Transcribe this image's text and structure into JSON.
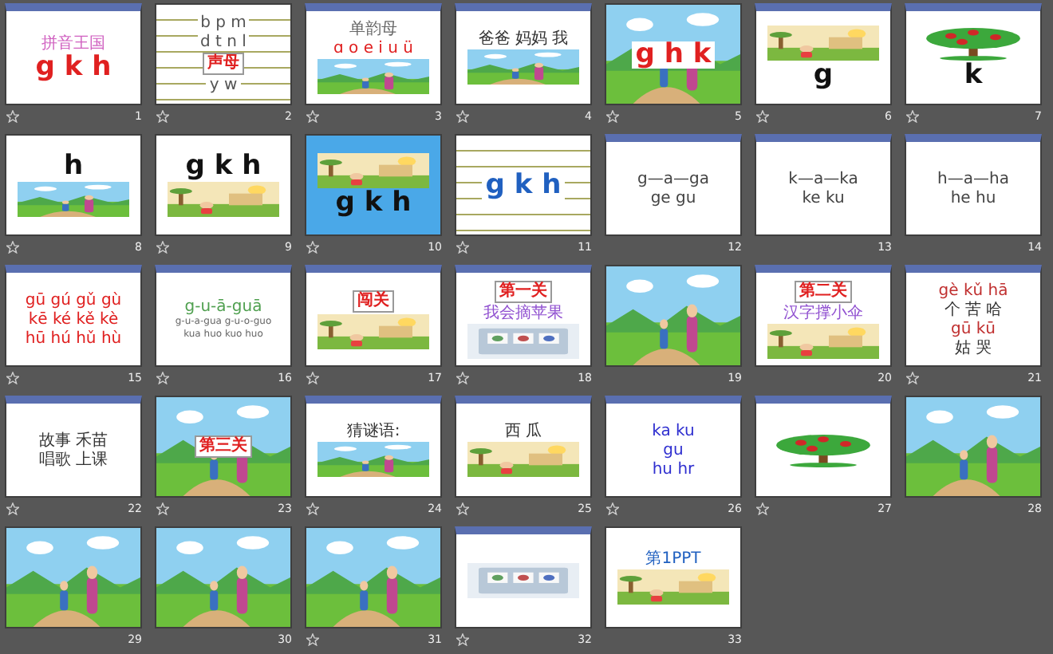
{
  "slides": [
    {
      "number": "1",
      "starred": true,
      "kind": "floral",
      "blocks": [
        {
          "kind": "heading",
          "text": "拼音王国",
          "color": "#d060c0"
        },
        {
          "kind": "letters",
          "text": "g k h",
          "color": "#e02020"
        }
      ]
    },
    {
      "number": "2",
      "starred": true,
      "kind": "lined",
      "blocks": [
        {
          "kind": "row",
          "text": "b p m",
          "color": "#555555"
        },
        {
          "kind": "row",
          "text": "d t n l",
          "color": "#555555"
        },
        {
          "kind": "badge",
          "text": "声母",
          "color": "#e02020"
        },
        {
          "kind": "row",
          "text": "y w",
          "color": "#555555"
        }
      ]
    },
    {
      "number": "3",
      "starred": true,
      "kind": "floral",
      "blocks": [
        {
          "kind": "heading",
          "text": "单韵母",
          "color": "#666666"
        },
        {
          "kind": "row",
          "text": "ɑ o e i u ü",
          "color": "#e02020"
        },
        {
          "kind": "picture"
        }
      ]
    },
    {
      "number": "4",
      "starred": true,
      "kind": "floral",
      "blocks": [
        {
          "kind": "row",
          "text": "爸爸 妈妈 我",
          "color": "#333333"
        },
        {
          "kind": "picture"
        }
      ]
    },
    {
      "number": "5",
      "starred": true,
      "kind": "scene",
      "blocks": [
        {
          "kind": "letters",
          "text": "g h k",
          "color": "#e02020"
        }
      ]
    },
    {
      "number": "6",
      "starred": true,
      "kind": "floral",
      "blocks": [
        {
          "kind": "picture"
        },
        {
          "kind": "letters",
          "text": "g",
          "color": "#111111"
        }
      ]
    },
    {
      "number": "7",
      "starred": true,
      "kind": "floral",
      "blocks": [
        {
          "kind": "picture"
        },
        {
          "kind": "letters",
          "text": "k",
          "color": "#111111"
        }
      ]
    },
    {
      "number": "8",
      "starred": true,
      "kind": "plain",
      "blocks": [
        {
          "kind": "letters",
          "text": "h",
          "color": "#111111"
        },
        {
          "kind": "picture"
        }
      ]
    },
    {
      "number": "9",
      "starred": true,
      "kind": "plain",
      "blocks": [
        {
          "kind": "letters",
          "text": "g k h",
          "color": "#111111"
        },
        {
          "kind": "picture"
        }
      ]
    },
    {
      "number": "10",
      "starred": true,
      "kind": "blue",
      "blocks": [
        {
          "kind": "picture"
        },
        {
          "kind": "letters",
          "text": "g k h",
          "color": "#111111"
        }
      ]
    },
    {
      "number": "11",
      "starred": true,
      "kind": "lined",
      "blocks": [
        {
          "kind": "letters",
          "text": "g k h",
          "color": "#2060c0"
        }
      ]
    },
    {
      "number": "12",
      "starred": false,
      "kind": "floral",
      "blocks": [
        {
          "kind": "row",
          "text": "g—a—ga",
          "color": "#444444"
        },
        {
          "kind": "row",
          "text": "ge gu",
          "color": "#444444"
        }
      ]
    },
    {
      "number": "13",
      "starred": false,
      "kind": "floral",
      "blocks": [
        {
          "kind": "row",
          "text": "k—a—ka",
          "color": "#444444"
        },
        {
          "kind": "row",
          "text": "ke ku",
          "color": "#444444"
        }
      ]
    },
    {
      "number": "14",
      "starred": false,
      "kind": "floral",
      "blocks": [
        {
          "kind": "row",
          "text": "h—a—ha",
          "color": "#444444"
        },
        {
          "kind": "row",
          "text": "he hu",
          "color": "#444444"
        }
      ]
    },
    {
      "number": "15",
      "starred": true,
      "kind": "floral",
      "blocks": [
        {
          "kind": "row",
          "text": "gū gú gǔ gù",
          "color": "#e02020"
        },
        {
          "kind": "row",
          "text": "kē ké kě kè",
          "color": "#e02020"
        },
        {
          "kind": "row",
          "text": "hū hú hǔ hù",
          "color": "#e02020"
        }
      ]
    },
    {
      "number": "16",
      "starred": true,
      "kind": "floral",
      "blocks": [
        {
          "kind": "row",
          "text": "g-u-ā-guā",
          "color": "#50a050"
        },
        {
          "kind": "caption",
          "text": "g-u-a-gua g-u-o-guo",
          "color": "#666666"
        },
        {
          "kind": "caption",
          "text": "kua huo kuo huo",
          "color": "#666666"
        }
      ]
    },
    {
      "number": "17",
      "starred": true,
      "kind": "floral",
      "blocks": [
        {
          "kind": "badge",
          "text": "闯关",
          "color": "#e02020"
        },
        {
          "kind": "picture"
        }
      ]
    },
    {
      "number": "18",
      "starred": true,
      "kind": "floral",
      "blocks": [
        {
          "kind": "badge",
          "text": "第一关",
          "color": "#e02020"
        },
        {
          "kind": "heading",
          "text": "我会摘苹果",
          "color": "#9050d0"
        },
        {
          "kind": "picture"
        }
      ]
    },
    {
      "number": "19",
      "starred": false,
      "kind": "scene"
    },
    {
      "number": "20",
      "starred": false,
      "kind": "floral",
      "blocks": [
        {
          "kind": "badge",
          "text": "第二关",
          "color": "#e02020"
        },
        {
          "kind": "heading",
          "text": "汉字撑小伞",
          "color": "#9050d0"
        },
        {
          "kind": "picture"
        }
      ]
    },
    {
      "number": "21",
      "starred": true,
      "kind": "floral",
      "blocks": [
        {
          "kind": "row",
          "text": "gè kǔ hā",
          "color": "#c03030"
        },
        {
          "kind": "row",
          "text": "个 苦 哈",
          "color": "#333333"
        },
        {
          "kind": "row",
          "text": "gū kū",
          "color": "#c03030"
        },
        {
          "kind": "row",
          "text": "姑 哭",
          "color": "#333333"
        }
      ]
    },
    {
      "number": "22",
      "starred": true,
      "kind": "floral",
      "blocks": [
        {
          "kind": "row",
          "text": "故事 禾苗",
          "color": "#333333"
        },
        {
          "kind": "row",
          "text": "唱歌 上课",
          "color": "#333333"
        }
      ]
    },
    {
      "number": "23",
      "starred": true,
      "kind": "scene",
      "blocks": [
        {
          "kind": "badge",
          "text": "第三关",
          "color": "#e02020"
        }
      ]
    },
    {
      "number": "24",
      "starred": true,
      "kind": "floral",
      "blocks": [
        {
          "kind": "heading",
          "text": "猜谜语:",
          "color": "#333333"
        },
        {
          "kind": "picture"
        }
      ]
    },
    {
      "number": "25",
      "starred": true,
      "kind": "floral",
      "blocks": [
        {
          "kind": "heading",
          "text": "西 瓜",
          "color": "#333333"
        },
        {
          "kind": "picture"
        }
      ]
    },
    {
      "number": "26",
      "starred": true,
      "kind": "floral",
      "blocks": [
        {
          "kind": "row",
          "text": "ka ku",
          "color": "#3030d0"
        },
        {
          "kind": "row",
          "text": "gu",
          "color": "#3030d0"
        },
        {
          "kind": "row",
          "text": "hu hr",
          "color": "#3030d0"
        }
      ]
    },
    {
      "number": "27",
      "starred": true,
      "kind": "floral",
      "blocks": [
        {
          "kind": "picture"
        }
      ]
    },
    {
      "number": "28",
      "starred": false,
      "kind": "scene"
    },
    {
      "number": "29",
      "starred": false,
      "kind": "scene"
    },
    {
      "number": "30",
      "starred": false,
      "kind": "scene"
    },
    {
      "number": "31",
      "starred": true,
      "kind": "scene"
    },
    {
      "number": "32",
      "starred": true,
      "kind": "floral",
      "blocks": [
        {
          "kind": "picture"
        }
      ]
    },
    {
      "number": "33",
      "starred": false,
      "kind": "plain",
      "blocks": [
        {
          "kind": "heading",
          "text": "第1PPT",
          "color": "#2060c0"
        },
        {
          "kind": "picture"
        }
      ]
    }
  ]
}
